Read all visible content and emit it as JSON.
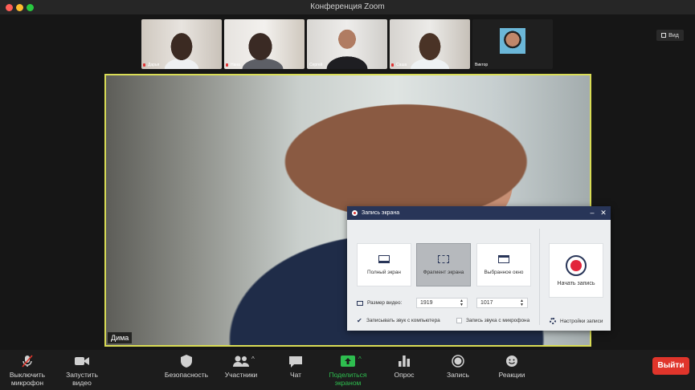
{
  "window": {
    "title": "Конференция Zoom",
    "traffic_colors": [
      "#ff5f57",
      "#febc2e",
      "#28c840"
    ]
  },
  "gallery": [
    {
      "name": "Дарья",
      "muted": true
    },
    {
      "name": "Нана",
      "muted": true
    },
    {
      "name": "Сергей",
      "muted": false
    },
    {
      "name": "Саша",
      "muted": true
    },
    {
      "name": "Виктор",
      "muted": false
    }
  ],
  "view_button": {
    "label": "Вид",
    "icon": "grid-icon"
  },
  "main_video": {
    "speaker_name": "Дима",
    "highlight_color": "#d9dc56"
  },
  "recorder": {
    "title": "Запись экрана",
    "minimize_icon": "minimize-icon",
    "close_icon": "close-icon",
    "options": [
      {
        "label": "Полный экран",
        "icon": "monitor-icon",
        "selected": false
      },
      {
        "label": "Фрагмент экрана",
        "icon": "crop-icon",
        "selected": true
      },
      {
        "label": "Выбранное окно",
        "icon": "window-icon",
        "selected": false
      }
    ],
    "start_label": "Начать запись",
    "size_label": "Размер видео:",
    "width_value": "1919",
    "height_value": "1017",
    "system_audio_label": "Записывать звук с компьютера",
    "system_audio_checked": true,
    "mic_audio_label": "Запись звука с микрофона",
    "mic_audio_checked": false,
    "settings_label": "Настройки записи",
    "accent_color": "#283558",
    "record_color": "#e2243b"
  },
  "toolbar": {
    "mute_label_1": "Выключить",
    "mute_label_2": "микрофон",
    "video_label_1": "Запустить",
    "video_label_2": "видео",
    "security_label": "Безопасность",
    "participants_label": "Участники",
    "chat_label": "Чат",
    "share_label_1": "Поделиться",
    "share_label_2": "экраном",
    "poll_label": "Опрос",
    "record_label": "Запись",
    "reactions_label": "Реакции",
    "exit_label": "Выйти",
    "share_color": "#2ebd4f",
    "exit_color": "#e0352b"
  }
}
